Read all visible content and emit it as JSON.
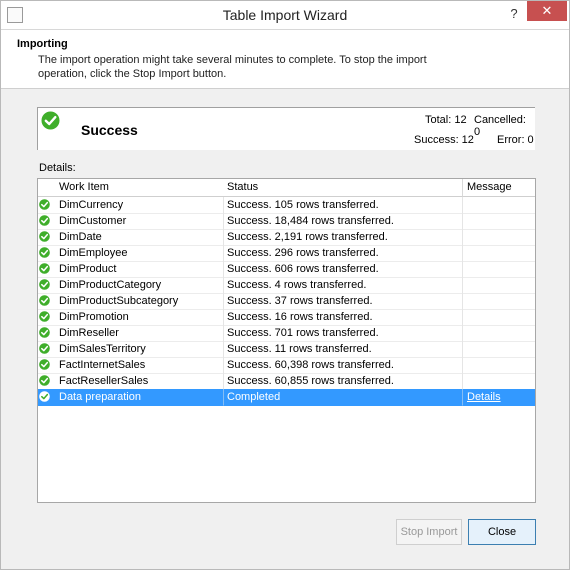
{
  "window": {
    "title": "Table Import Wizard",
    "help_label": "?",
    "close_label": "✕"
  },
  "header": {
    "heading": "Importing",
    "description": "The import operation might take several minutes to complete. To stop the import operation, click the Stop Import button."
  },
  "summary": {
    "status": "Success",
    "total": "Total: 12",
    "cancelled": "Cancelled: 0",
    "success": "Success: 12",
    "error": "Error: 0"
  },
  "details_label": "Details:",
  "table": {
    "columns": [
      "Work Item",
      "Status",
      "Message"
    ],
    "rows": [
      {
        "work_item": "DimCurrency",
        "status": "Success. 105 rows transferred.",
        "message": ""
      },
      {
        "work_item": "DimCustomer",
        "status": "Success. 18,484 rows transferred.",
        "message": ""
      },
      {
        "work_item": "DimDate",
        "status": "Success. 2,191 rows transferred.",
        "message": ""
      },
      {
        "work_item": "DimEmployee",
        "status": "Success. 296 rows transferred.",
        "message": ""
      },
      {
        "work_item": "DimProduct",
        "status": "Success. 606 rows transferred.",
        "message": ""
      },
      {
        "work_item": "DimProductCategory",
        "status": "Success. 4 rows transferred.",
        "message": ""
      },
      {
        "work_item": "DimProductSubcategory",
        "status": "Success. 37 rows transferred.",
        "message": ""
      },
      {
        "work_item": "DimPromotion",
        "status": "Success. 16 rows transferred.",
        "message": ""
      },
      {
        "work_item": "DimReseller",
        "status": "Success. 701 rows transferred.",
        "message": ""
      },
      {
        "work_item": "DimSalesTerritory",
        "status": "Success. 11 rows transferred.",
        "message": ""
      },
      {
        "work_item": "FactInternetSales",
        "status": "Success. 60,398 rows transferred.",
        "message": ""
      },
      {
        "work_item": "FactResellerSales",
        "status": "Success. 60,855 rows transferred.",
        "message": ""
      },
      {
        "work_item": "Data preparation",
        "status": "Completed",
        "message": "Details",
        "selected": true
      }
    ]
  },
  "buttons": {
    "stop_import": "Stop Import",
    "close": "Close"
  },
  "colors": {
    "success_green": "#3fae2a",
    "selection_blue": "#3399ff",
    "close_red": "#c75050"
  },
  "icons": {
    "success": "check-circle-icon"
  }
}
